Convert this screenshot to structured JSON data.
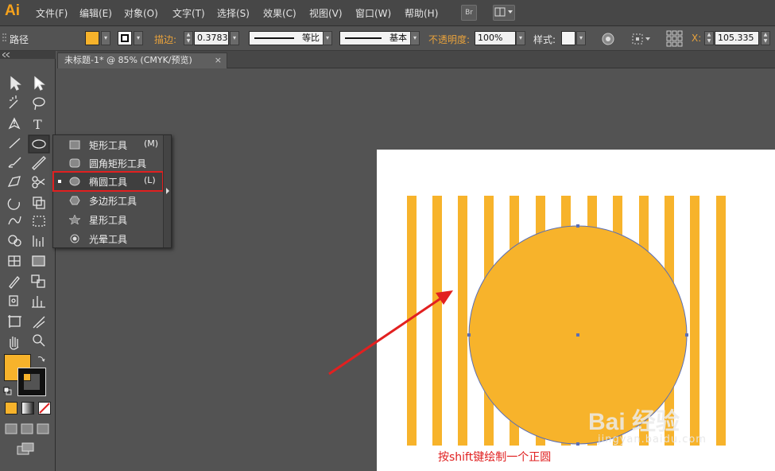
{
  "app": {
    "logo": "Ai"
  },
  "menubar": {
    "items": [
      "文件(F)",
      "编辑(E)",
      "对象(O)",
      "文字(T)",
      "选择(S)",
      "效果(C)",
      "视图(V)",
      "窗口(W)",
      "帮助(H)"
    ],
    "bridge_label": "Br"
  },
  "control_bar": {
    "selection_type": "路径",
    "stroke_label": "描边:",
    "stroke_weight": "0.3783",
    "stroke_profile": "等比",
    "brush": "基本",
    "opacity_label": "不透明度:",
    "opacity": "100%",
    "style_label": "样式:",
    "x_label": "X:",
    "x_value": "105.335"
  },
  "document": {
    "tab_title": "未标题-1* @ 85% (CMYK/预览)",
    "close_glyph": "×"
  },
  "flyout": {
    "items": [
      {
        "label": "矩形工具",
        "key": "(M)",
        "icon": "rectangle-icon"
      },
      {
        "label": "圆角矩形工具",
        "key": "",
        "icon": "rounded-rectangle-icon"
      },
      {
        "label": "椭圆工具",
        "key": "(L)",
        "icon": "ellipse-icon"
      },
      {
        "label": "多边形工具",
        "key": "",
        "icon": "polygon-icon"
      },
      {
        "label": "星形工具",
        "key": "",
        "icon": "star-icon"
      },
      {
        "label": "光晕工具",
        "key": "",
        "icon": "flare-icon"
      }
    ],
    "selected_index": 2
  },
  "toolbox": {
    "tools": [
      "selection-tool",
      "direct-selection-tool",
      "magic-wand-tool",
      "lasso-tool",
      "pen-tool",
      "type-tool",
      "line-tool",
      "ellipse-tool",
      "paintbrush-tool",
      "pencil-tool",
      "blob-brush-tool",
      "scissors-tool",
      "rotate-tool",
      "scale-tool",
      "warp-tool",
      "free-transform-tool",
      "shape-builder-tool",
      "graph-tool",
      "mesh-tool",
      "gradient-tool",
      "eyedropper-tool",
      "blend-tool",
      "symbol-sprayer-tool",
      "column-graph-tool",
      "artboard-tool",
      "slice-tool",
      "hand-tool",
      "zoom-tool"
    ]
  },
  "colors": {
    "fill": "#f7b32b",
    "stripe": "#f7b32b",
    "circle": "#f7b32b",
    "arrow": "#e22020",
    "highlight": "#e02020",
    "ui_dark": "#535353"
  },
  "annotation": {
    "caption": "按shift键绘制一个正圆"
  },
  "watermark": {
    "text": "Bai 经验",
    "url": "jingyan.baidu.com"
  }
}
